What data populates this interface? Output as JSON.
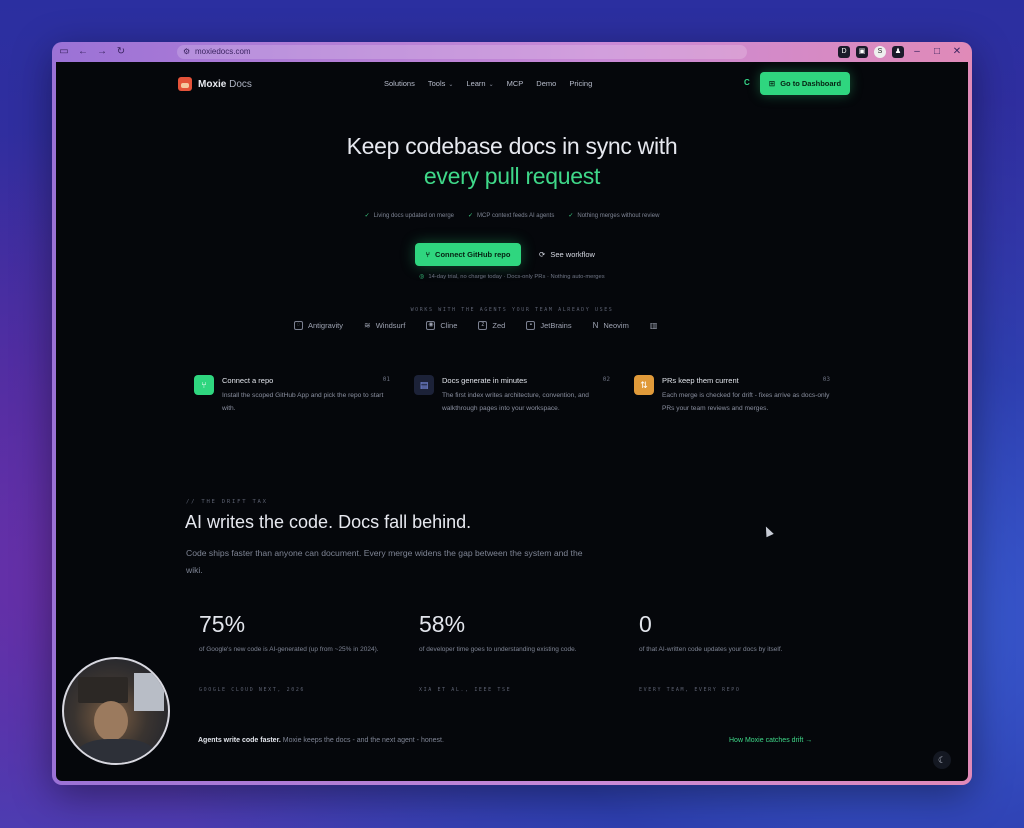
{
  "browser": {
    "url": "moxiedocs.com",
    "extensions": [
      "D",
      "",
      "S",
      ""
    ]
  },
  "nav": {
    "brand_main": "Moxie",
    "brand_sub": "Docs",
    "menu": [
      "Solutions",
      "Tools",
      "Learn",
      "MCP",
      "Demo",
      "Pricing"
    ],
    "c_label": "C",
    "dashboard_label": "Go to Dashboard"
  },
  "hero": {
    "title": "Keep codebase docs in sync with",
    "accent": "every pull request",
    "checks": [
      "Living docs updated on merge",
      "MCP context feeds AI agents",
      "Nothing merges without review"
    ],
    "primary_cta": "Connect GitHub repo",
    "secondary_cta": "See workflow",
    "trial": "14-day trial, no charge today · Docs-only PRs · Nothing auto-merges"
  },
  "agents": {
    "label": "WORKS WITH THE AGENTS YOUR TEAM ALREADY USES",
    "items": [
      "Antigravity",
      "Windsurf",
      "Cline",
      "Zed",
      "JetBrains",
      "Neovim"
    ]
  },
  "steps": [
    {
      "title": "Connect a repo",
      "num": "01",
      "desc": "Install the scoped GitHub App and pick the repo to start with.",
      "color": "#2fd67f"
    },
    {
      "title": "Docs generate in minutes",
      "num": "02",
      "desc": "The first index writes architecture, convention, and walkthrough pages into your workspace.",
      "color": "#2b3150"
    },
    {
      "title": "PRs keep them current",
      "num": "03",
      "desc": "Each merge is checked for drift - fixes arrive as docs-only PRs your team reviews and merges.",
      "color": "#e09a3a"
    }
  ],
  "drift": {
    "eyebrow": "// THE DRIFT TAX",
    "title": "AI writes the code. Docs fall behind.",
    "desc": "Code ships faster than anyone can document. Every merge widens the gap between the system and the wiki."
  },
  "stats": [
    {
      "value": "75%",
      "desc": "of Google's new code is AI-generated (up from ~25% in 2024).",
      "source": "GOOGLE CLOUD NEXT, 2026"
    },
    {
      "value": "58%",
      "desc": "of developer time goes to understanding existing code.",
      "source": "XIA ET AL., IEEE TSE"
    },
    {
      "value": "0",
      "desc": "of that AI-written code updates your docs by itself.",
      "source": "EVERY TEAM, EVERY REPO"
    }
  ],
  "footer": {
    "bold": "Agents write code faster.",
    "rest": " Moxie keeps the docs - and the next agent - honest.",
    "link": "How Moxie catches drift →"
  }
}
